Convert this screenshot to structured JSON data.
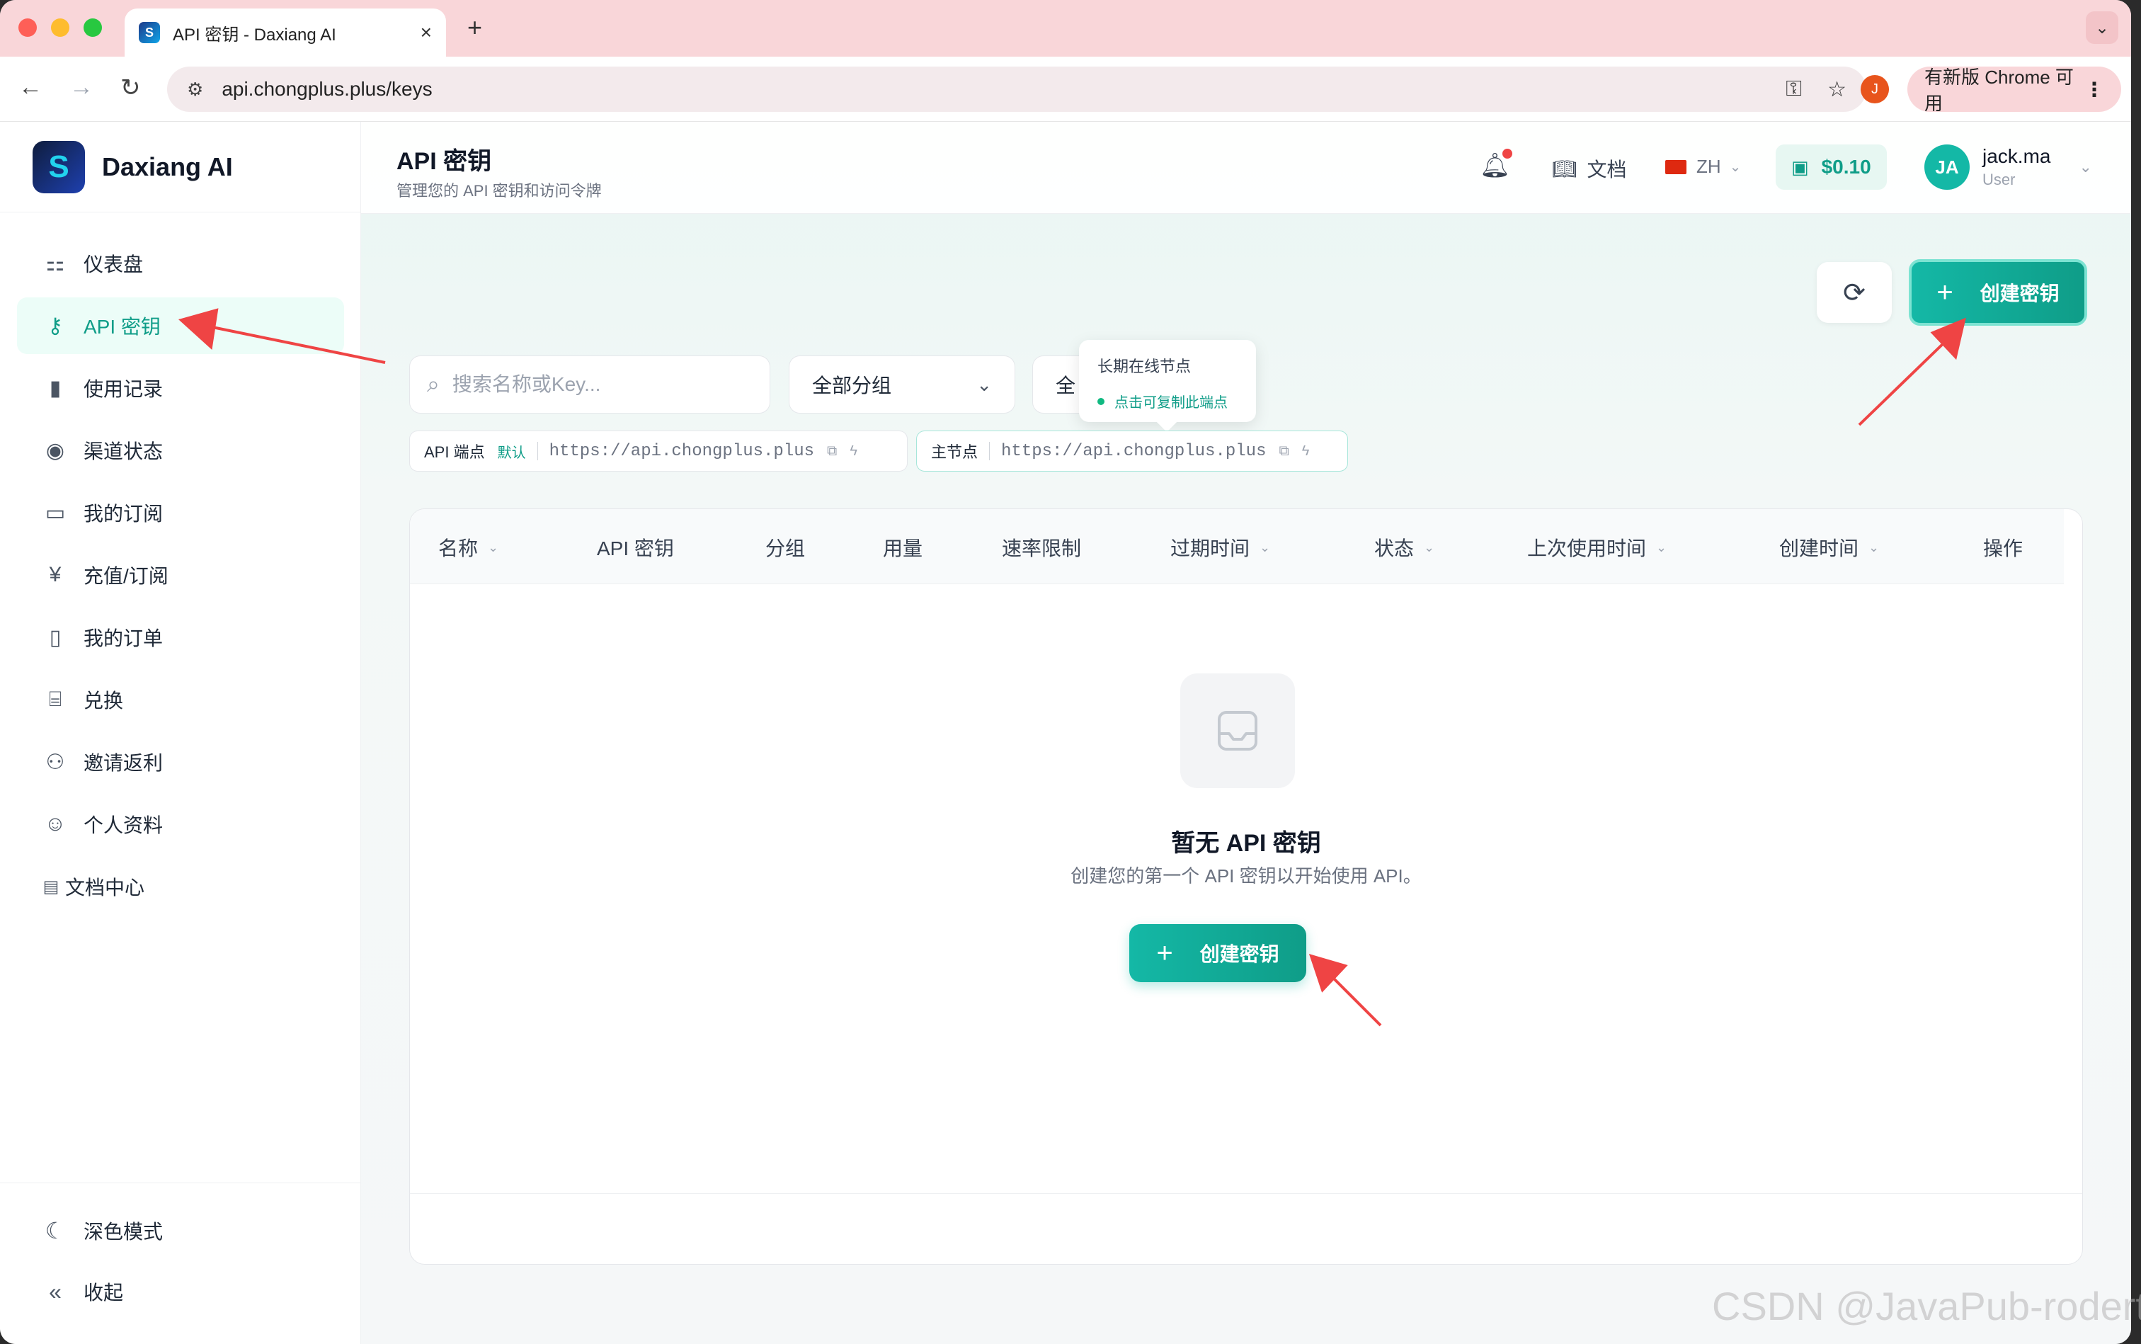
{
  "browser": {
    "tab_title": "API 密钥 - Daxiang AI",
    "url": "api.chongplus.plus/keys",
    "update_label": "有新版 Chrome 可用",
    "profile_initial": "J"
  },
  "brand": {
    "name": "Daxiang AI"
  },
  "sidebar": {
    "items": [
      {
        "label": "仪表盘",
        "icon": "dashboard-icon"
      },
      {
        "label": "API 密钥",
        "icon": "key-icon",
        "active": true
      },
      {
        "label": "使用记录",
        "icon": "bar-chart-icon"
      },
      {
        "label": "渠道状态",
        "icon": "signal-icon"
      },
      {
        "label": "我的订阅",
        "icon": "credit-card-icon"
      },
      {
        "label": "充值/订阅",
        "icon": "yen-coin-icon"
      },
      {
        "label": "我的订单",
        "icon": "document-icon"
      },
      {
        "label": "兑换",
        "icon": "gift-icon"
      },
      {
        "label": "邀请返利",
        "icon": "users-icon"
      },
      {
        "label": "个人资料",
        "icon": "user-icon"
      },
      {
        "label": "文档中心",
        "icon": "books-icon"
      }
    ],
    "dark_mode_label": "深色模式",
    "collapse_label": "收起"
  },
  "header": {
    "title": "API 密钥",
    "subtitle": "管理您的 API 密钥和访问令牌",
    "docs_label": "文档",
    "lang_label": "ZH",
    "balance": "$0.10",
    "user_initials": "JA",
    "user_name": "jack.ma",
    "user_role": "User"
  },
  "toolbar": {
    "create_label": "创建密钥",
    "search_placeholder": "搜索名称或Key...",
    "group_filter": "全部分组",
    "status_filter": "全"
  },
  "endpoints": [
    {
      "label": "API 端点",
      "badge": "默认",
      "url": "https://api.chongplus.plus"
    },
    {
      "label": "主节点",
      "url": "https://api.chongplus.plus"
    }
  ],
  "tooltip": {
    "title": "长期在线节点",
    "hint": "点击可复制此端点"
  },
  "table": {
    "columns": [
      {
        "label": "名称",
        "sortable": true
      },
      {
        "label": "API 密钥",
        "sortable": false
      },
      {
        "label": "分组",
        "sortable": false
      },
      {
        "label": "用量",
        "sortable": false
      },
      {
        "label": "速率限制",
        "sortable": false
      },
      {
        "label": "过期时间",
        "sortable": true
      },
      {
        "label": "状态",
        "sortable": true
      },
      {
        "label": "上次使用时间",
        "sortable": true
      },
      {
        "label": "创建时间",
        "sortable": true
      },
      {
        "label": "操作",
        "sortable": false
      }
    ],
    "empty_title": "暂无 API 密钥",
    "empty_desc": "创建您的第一个 API 密钥以开始使用 API。",
    "empty_create_label": "创建密钥"
  },
  "colors": {
    "accent": "#14b8a6",
    "accent_dark": "#0f9d88",
    "annotation_arrow": "#ef4444"
  },
  "watermark": "CSDN @JavaPub-rodert"
}
